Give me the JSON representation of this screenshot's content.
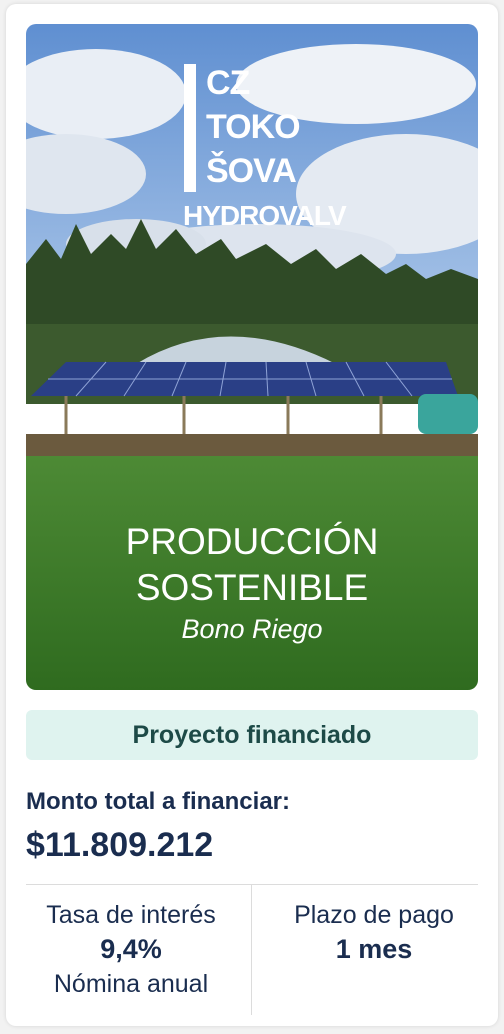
{
  "hero": {
    "logo_lines": [
      "CZ",
      "TOKO",
      "ŠOVA"
    ],
    "logo_sub": "HYDROVALV",
    "title_line1": "PRODUCCIÓN",
    "title_line2": "SOSTENIBLE",
    "subtitle": "Bono Riego"
  },
  "status_badge": "Proyecto financiado",
  "amount": {
    "label": "Monto total a financiar:",
    "value": "$11.809.212"
  },
  "terms": {
    "rate_label": "Tasa de interés",
    "rate_value": "9,4%",
    "rate_note": "Nómina anual",
    "term_label": "Plazo de pago",
    "term_value": "1 mes"
  }
}
